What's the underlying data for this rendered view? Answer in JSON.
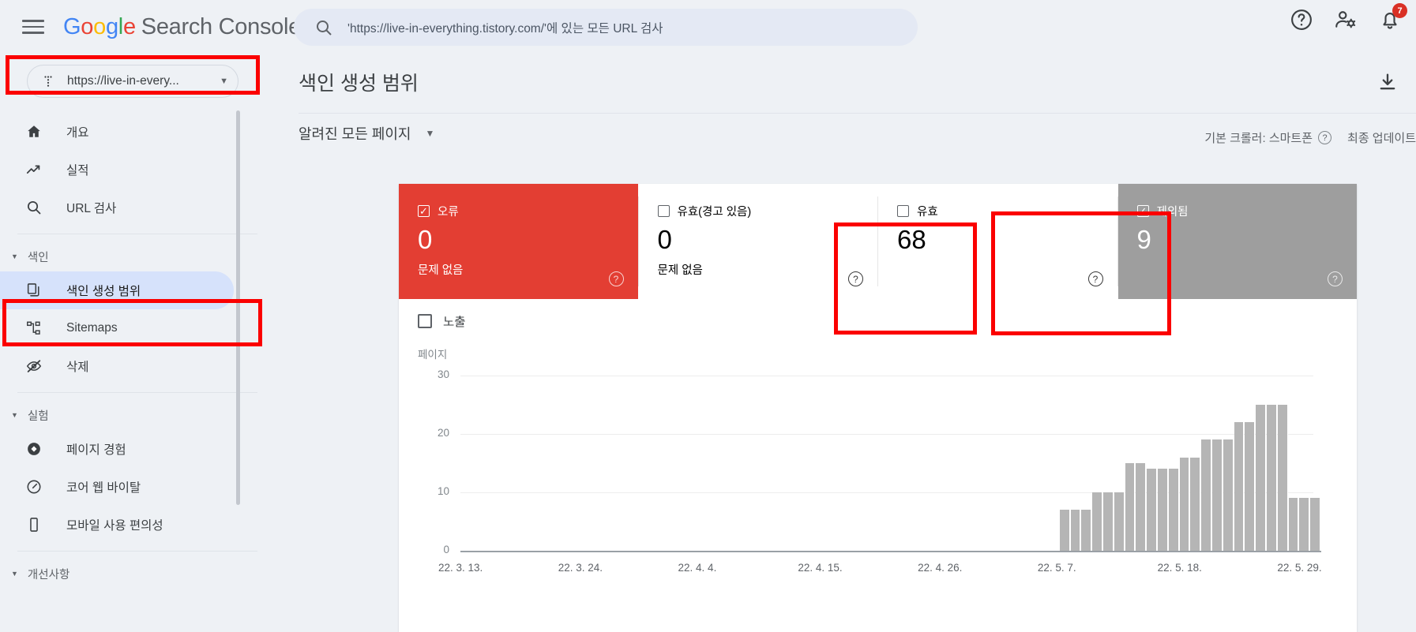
{
  "topbar": {
    "menu_icon": "hamburger-icon",
    "brand_google": [
      "G",
      "o",
      "o",
      "g",
      "l",
      "e"
    ],
    "brand_suffix": "Search Console",
    "search": {
      "icon": "search-icon",
      "value": "'https://live-in-everything.tistory.com/'에 있는 모든 URL 검사"
    },
    "icons": [
      {
        "name": "help-icon",
        "label": "?"
      },
      {
        "name": "account-settings-icon",
        "label": ""
      },
      {
        "name": "notifications-icon",
        "label": "",
        "badge": "7"
      }
    ]
  },
  "sidebar": {
    "property": {
      "icon": "property-selector-icon",
      "label": "https://live-in-every...",
      "caret": "▼"
    },
    "items": [
      {
        "name": "overview",
        "icon": "home-icon",
        "label": "개요",
        "type": "item"
      },
      {
        "name": "performance",
        "icon": "trending-up-icon",
        "label": "실적",
        "type": "item"
      },
      {
        "name": "url-inspection",
        "icon": "search-icon",
        "label": "URL 검사",
        "type": "item"
      },
      {
        "name": "divider-1",
        "type": "divider"
      },
      {
        "name": "index-group",
        "icon": "caret-down-icon",
        "label": "색인",
        "type": "group"
      },
      {
        "name": "coverage",
        "icon": "pages-icon",
        "label": "색인 생성 범위",
        "type": "item",
        "active": true
      },
      {
        "name": "sitemaps",
        "icon": "sitemap-icon",
        "label": "Sitemaps",
        "type": "item"
      },
      {
        "name": "removals",
        "icon": "eye-off-icon",
        "label": "삭제",
        "type": "item"
      },
      {
        "name": "divider-2",
        "type": "divider"
      },
      {
        "name": "experience-group",
        "icon": "caret-down-icon",
        "label": "실험",
        "type": "group"
      },
      {
        "name": "page-experience",
        "icon": "page-experience-icon",
        "label": "페이지 경험",
        "type": "item"
      },
      {
        "name": "core-web-vitals",
        "icon": "speedometer-icon",
        "label": "코어 웹 바이탈",
        "type": "item"
      },
      {
        "name": "mobile-usability",
        "icon": "mobile-icon",
        "label": "모바일 사용 편의성",
        "type": "item"
      },
      {
        "name": "divider-3",
        "type": "divider"
      },
      {
        "name": "enhancements-group",
        "icon": "caret-down-icon",
        "label": "개선사항",
        "type": "group"
      }
    ]
  },
  "main": {
    "title": "색인 생성 범위",
    "download_icon": "download-icon",
    "filter": {
      "label": "알려진 모든 페이지",
      "caret": "▼"
    },
    "crawler": {
      "text": "기본 크롤러: 스마트폰",
      "help": "?",
      "updated": "최종 업데이트"
    },
    "tiles": [
      {
        "name": "tile-error",
        "label": "오류",
        "checked": true,
        "value": "0",
        "sub": "문제 없음",
        "style": "error",
        "help": "?"
      },
      {
        "name": "tile-valid-with-warnings",
        "label": "유효(경고 있음)",
        "checked": false,
        "value": "0",
        "sub": "문제 없음",
        "style": "plain",
        "help": "?"
      },
      {
        "name": "tile-valid",
        "label": "유효",
        "checked": false,
        "value": "68",
        "sub": "",
        "style": "plain",
        "help": "?"
      },
      {
        "name": "tile-excluded",
        "label": "제외됨",
        "checked": true,
        "value": "9",
        "sub": "",
        "style": "excluded",
        "help": "?"
      }
    ],
    "impressions": {
      "label": "노출",
      "checked": false
    }
  },
  "colors": {
    "error_red": "#e33e33",
    "excluded_gray": "#9e9e9e",
    "bar_gray": "#b5b5b5",
    "highlight_box": "#fb0000",
    "active_nav": "#d6e2fb"
  },
  "chart_data": {
    "type": "bar",
    "title": "",
    "ylabel": "페이지",
    "xlabel": "",
    "ylim": [
      0,
      30
    ],
    "yticks": [
      0,
      10,
      20,
      30
    ],
    "grid": true,
    "legend": "none",
    "xticks": [
      "22. 3. 13.",
      "22. 3. 24.",
      "22. 4. 4.",
      "22. 4. 15.",
      "22. 4. 26.",
      "22. 5. 7.",
      "22. 5. 18.",
      "22. 5. 29."
    ],
    "x": [
      "22.3.13",
      "22.3.14",
      "22.3.15",
      "22.3.16",
      "22.3.17",
      "22.3.18",
      "22.3.19",
      "22.3.20",
      "22.3.21",
      "22.3.22",
      "22.3.23",
      "22.3.24",
      "22.3.25",
      "22.3.26",
      "22.3.27",
      "22.3.28",
      "22.3.29",
      "22.3.30",
      "22.3.31",
      "22.4.1",
      "22.4.2",
      "22.4.3",
      "22.4.4",
      "22.4.5",
      "22.4.6",
      "22.4.7",
      "22.4.8",
      "22.4.9",
      "22.4.10",
      "22.4.11",
      "22.4.12",
      "22.4.13",
      "22.4.14",
      "22.4.15",
      "22.4.16",
      "22.4.17",
      "22.4.18",
      "22.4.19",
      "22.4.20",
      "22.4.21",
      "22.4.22",
      "22.4.23",
      "22.4.24",
      "22.4.25",
      "22.4.26",
      "22.4.27",
      "22.4.28",
      "22.4.29",
      "22.4.30",
      "22.5.1",
      "22.5.2",
      "22.5.3",
      "22.5.4",
      "22.5.5",
      "22.5.6",
      "22.5.7",
      "22.5.8",
      "22.5.9",
      "22.5.10",
      "22.5.11",
      "22.5.12",
      "22.5.13",
      "22.5.14",
      "22.5.15",
      "22.5.16",
      "22.5.17",
      "22.5.18",
      "22.5.19",
      "22.5.20",
      "22.5.21",
      "22.5.22",
      "22.5.23",
      "22.5.24",
      "22.5.25",
      "22.5.26",
      "22.5.27",
      "22.5.28",
      "22.5.29",
      "22.5.30",
      "22.5.31",
      "22.6.1",
      "22.6.2",
      "22.6.3"
    ],
    "series": [
      {
        "name": "제외됨",
        "color": "#b5b5b5",
        "values": [
          0,
          0,
          0,
          0,
          0,
          0,
          0,
          0,
          0,
          0,
          0,
          0,
          0,
          0,
          0,
          0,
          0,
          0,
          0,
          0,
          0,
          0,
          0,
          0,
          0,
          0,
          0,
          0,
          0,
          0,
          0,
          0,
          0,
          0,
          0,
          0,
          0,
          0,
          0,
          0,
          0,
          0,
          0,
          0,
          0,
          0,
          0,
          0,
          0,
          0,
          0,
          0,
          0,
          0,
          0,
          7,
          7,
          7,
          10,
          10,
          10,
          15,
          15,
          14,
          14,
          14,
          16,
          16,
          19,
          19,
          19,
          22,
          22,
          25,
          25,
          25,
          9,
          9,
          9
        ]
      }
    ]
  }
}
